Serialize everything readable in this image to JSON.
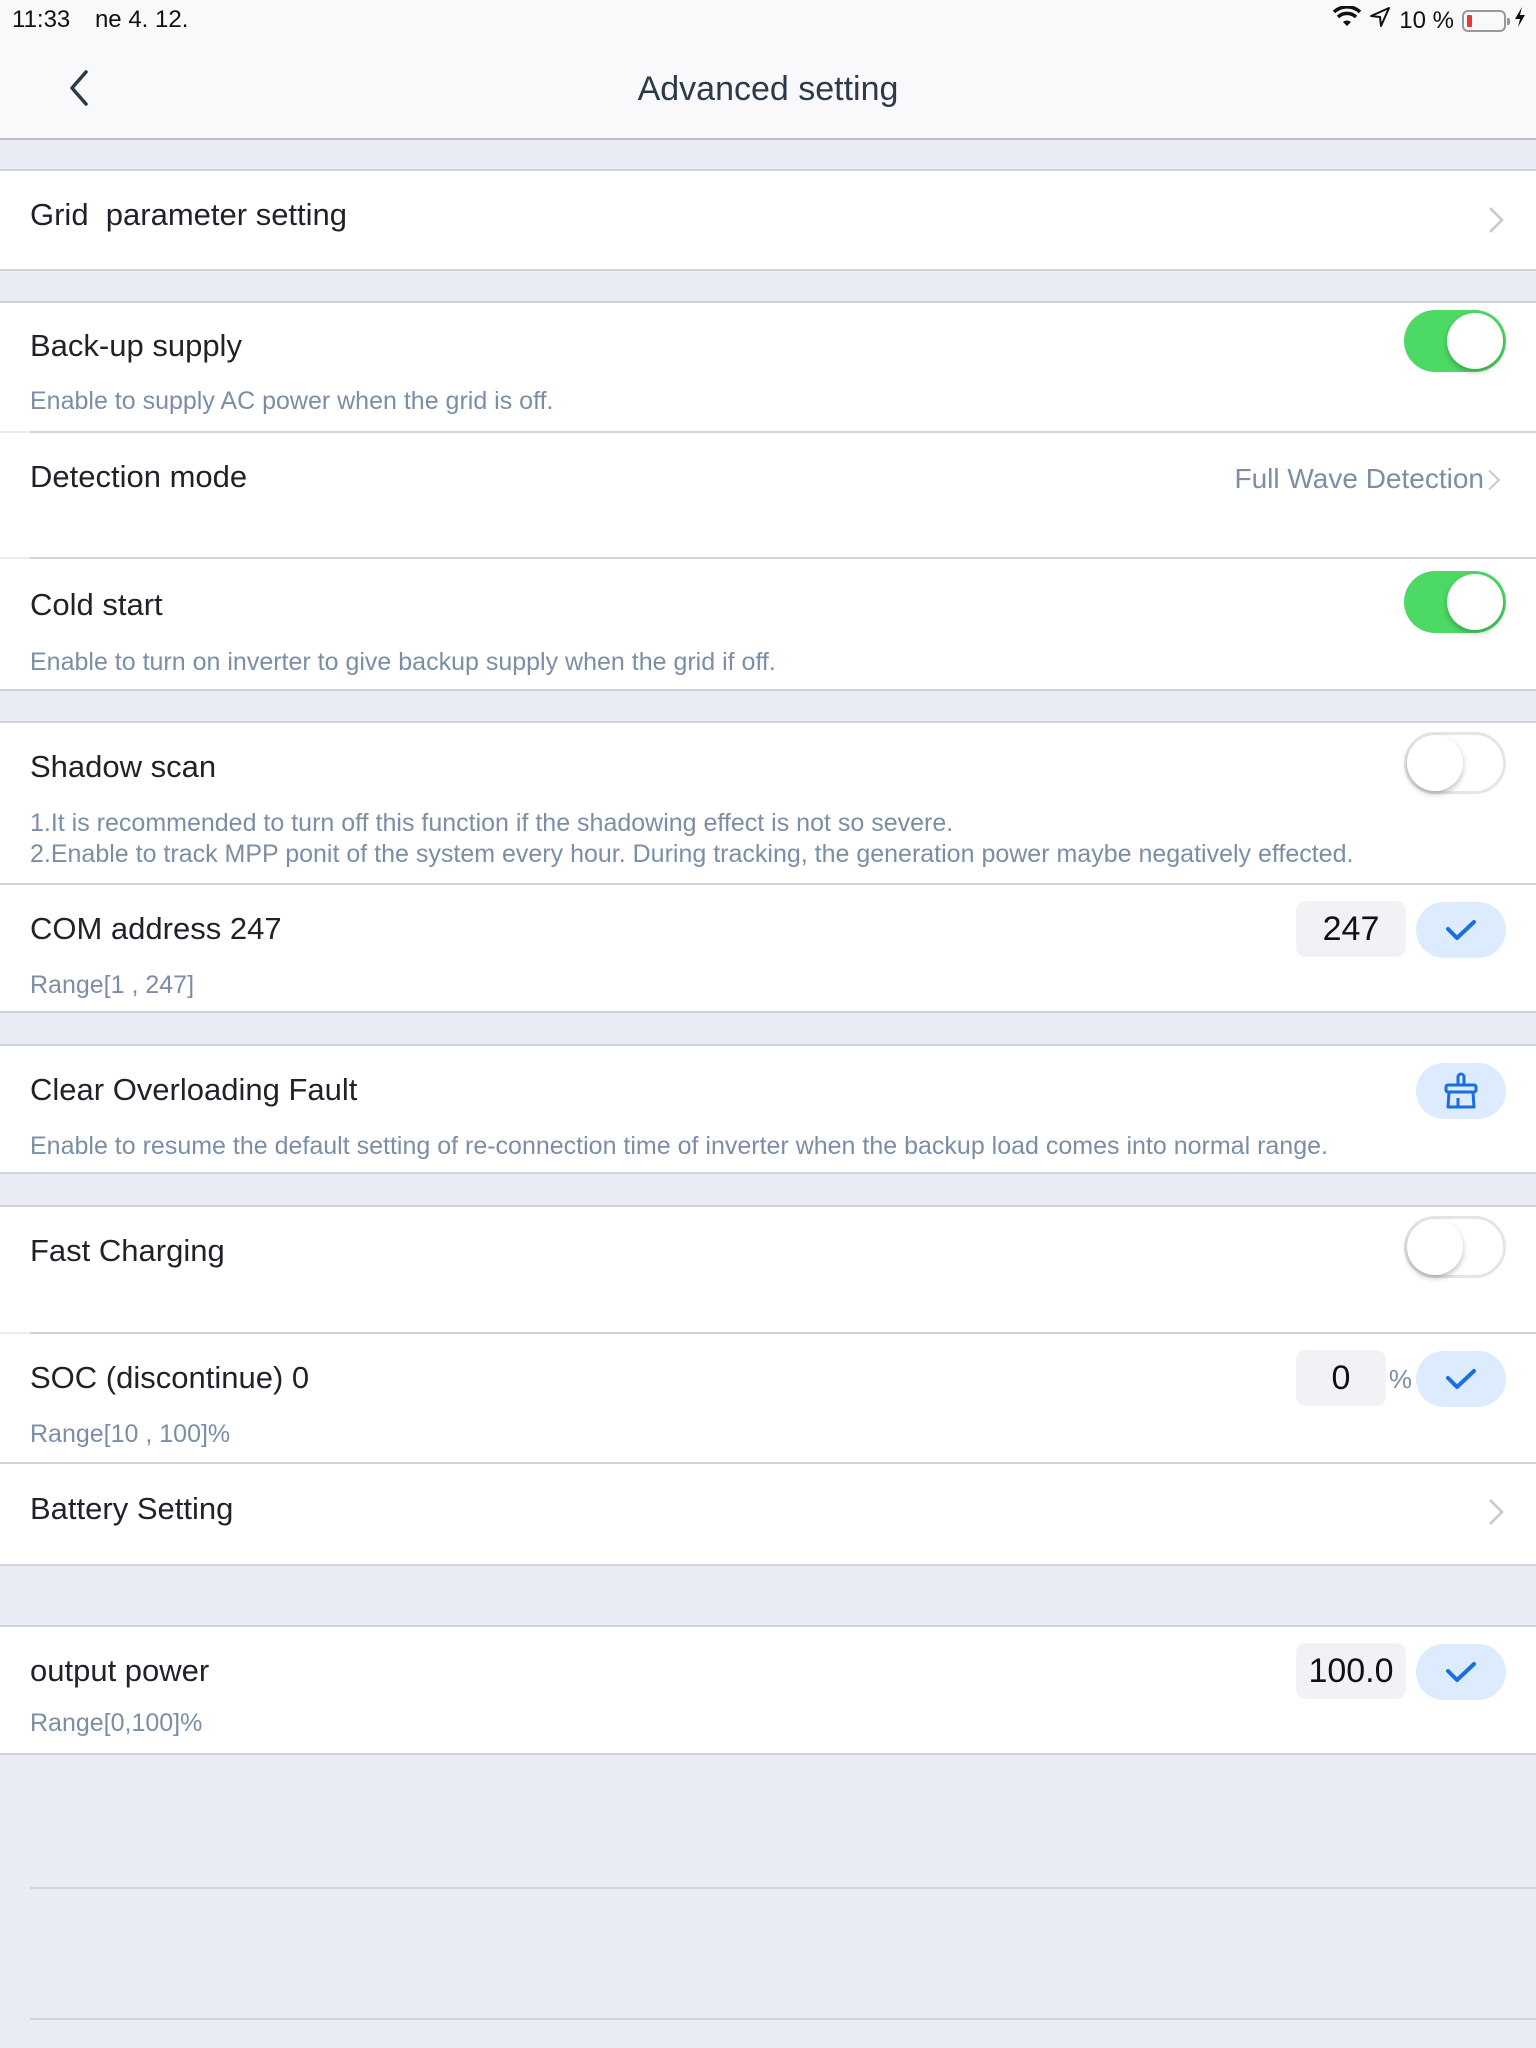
{
  "status_bar": {
    "time": "11:33",
    "date": "ne 4. 12.",
    "battery_percent": "10 %",
    "battery_level": 0.1,
    "icons": [
      "wifi-icon",
      "location-arrow-icon",
      "battery-icon",
      "charging-bolt-icon"
    ]
  },
  "nav": {
    "title": "Advanced setting",
    "back_icon": "chevron-left-icon"
  },
  "colors": {
    "toggle_on": "#4cd964",
    "accent_blue": "#1a6fe0",
    "button_bg": "#dcebfd",
    "desc_text": "#7b8ea6"
  },
  "settings": {
    "grid_parameter": {
      "label": "Grid  parameter setting",
      "icon": "chevron-right-icon"
    },
    "backup_supply": {
      "label": "Back-up supply",
      "description": "Enable to supply AC power when the grid is off.",
      "enabled": true
    },
    "detection_mode": {
      "label": "Detection mode",
      "value": "Full Wave Detection",
      "icon": "chevron-right-icon"
    },
    "cold_start": {
      "label": "Cold start",
      "description": "Enable to turn on inverter to give backup supply when the grid if off.",
      "enabled": true
    },
    "shadow_scan": {
      "label": "Shadow scan",
      "description_1": "1.It is recommended to turn off this function if the shadowing effect is not so severe.",
      "description_2": "2.Enable to track MPP ponit of the system every hour. During tracking, the generation power maybe negatively effected.",
      "enabled": false
    },
    "com_address": {
      "label": "COM address 247",
      "value": "247",
      "range": "Range[1 , 247]",
      "confirm_icon": "checkmark-icon"
    },
    "clear_overloading": {
      "label": "Clear Overloading Fault",
      "description": "Enable to resume the default setting of re-connection time of inverter when the backup load comes into normal range.",
      "button_icon": "broom-icon"
    },
    "fast_charging": {
      "label": "Fast Charging",
      "enabled": false
    },
    "soc": {
      "label": "SOC (discontinue) 0",
      "value": "0",
      "unit": "%",
      "range": "Range[10 , 100]%",
      "confirm_icon": "checkmark-icon"
    },
    "battery_setting": {
      "label": "Battery Setting",
      "icon": "chevron-right-icon"
    },
    "output_power": {
      "label": "output power",
      "value": "100.0",
      "range": "Range[0,100]%",
      "confirm_icon": "checkmark-icon"
    }
  }
}
